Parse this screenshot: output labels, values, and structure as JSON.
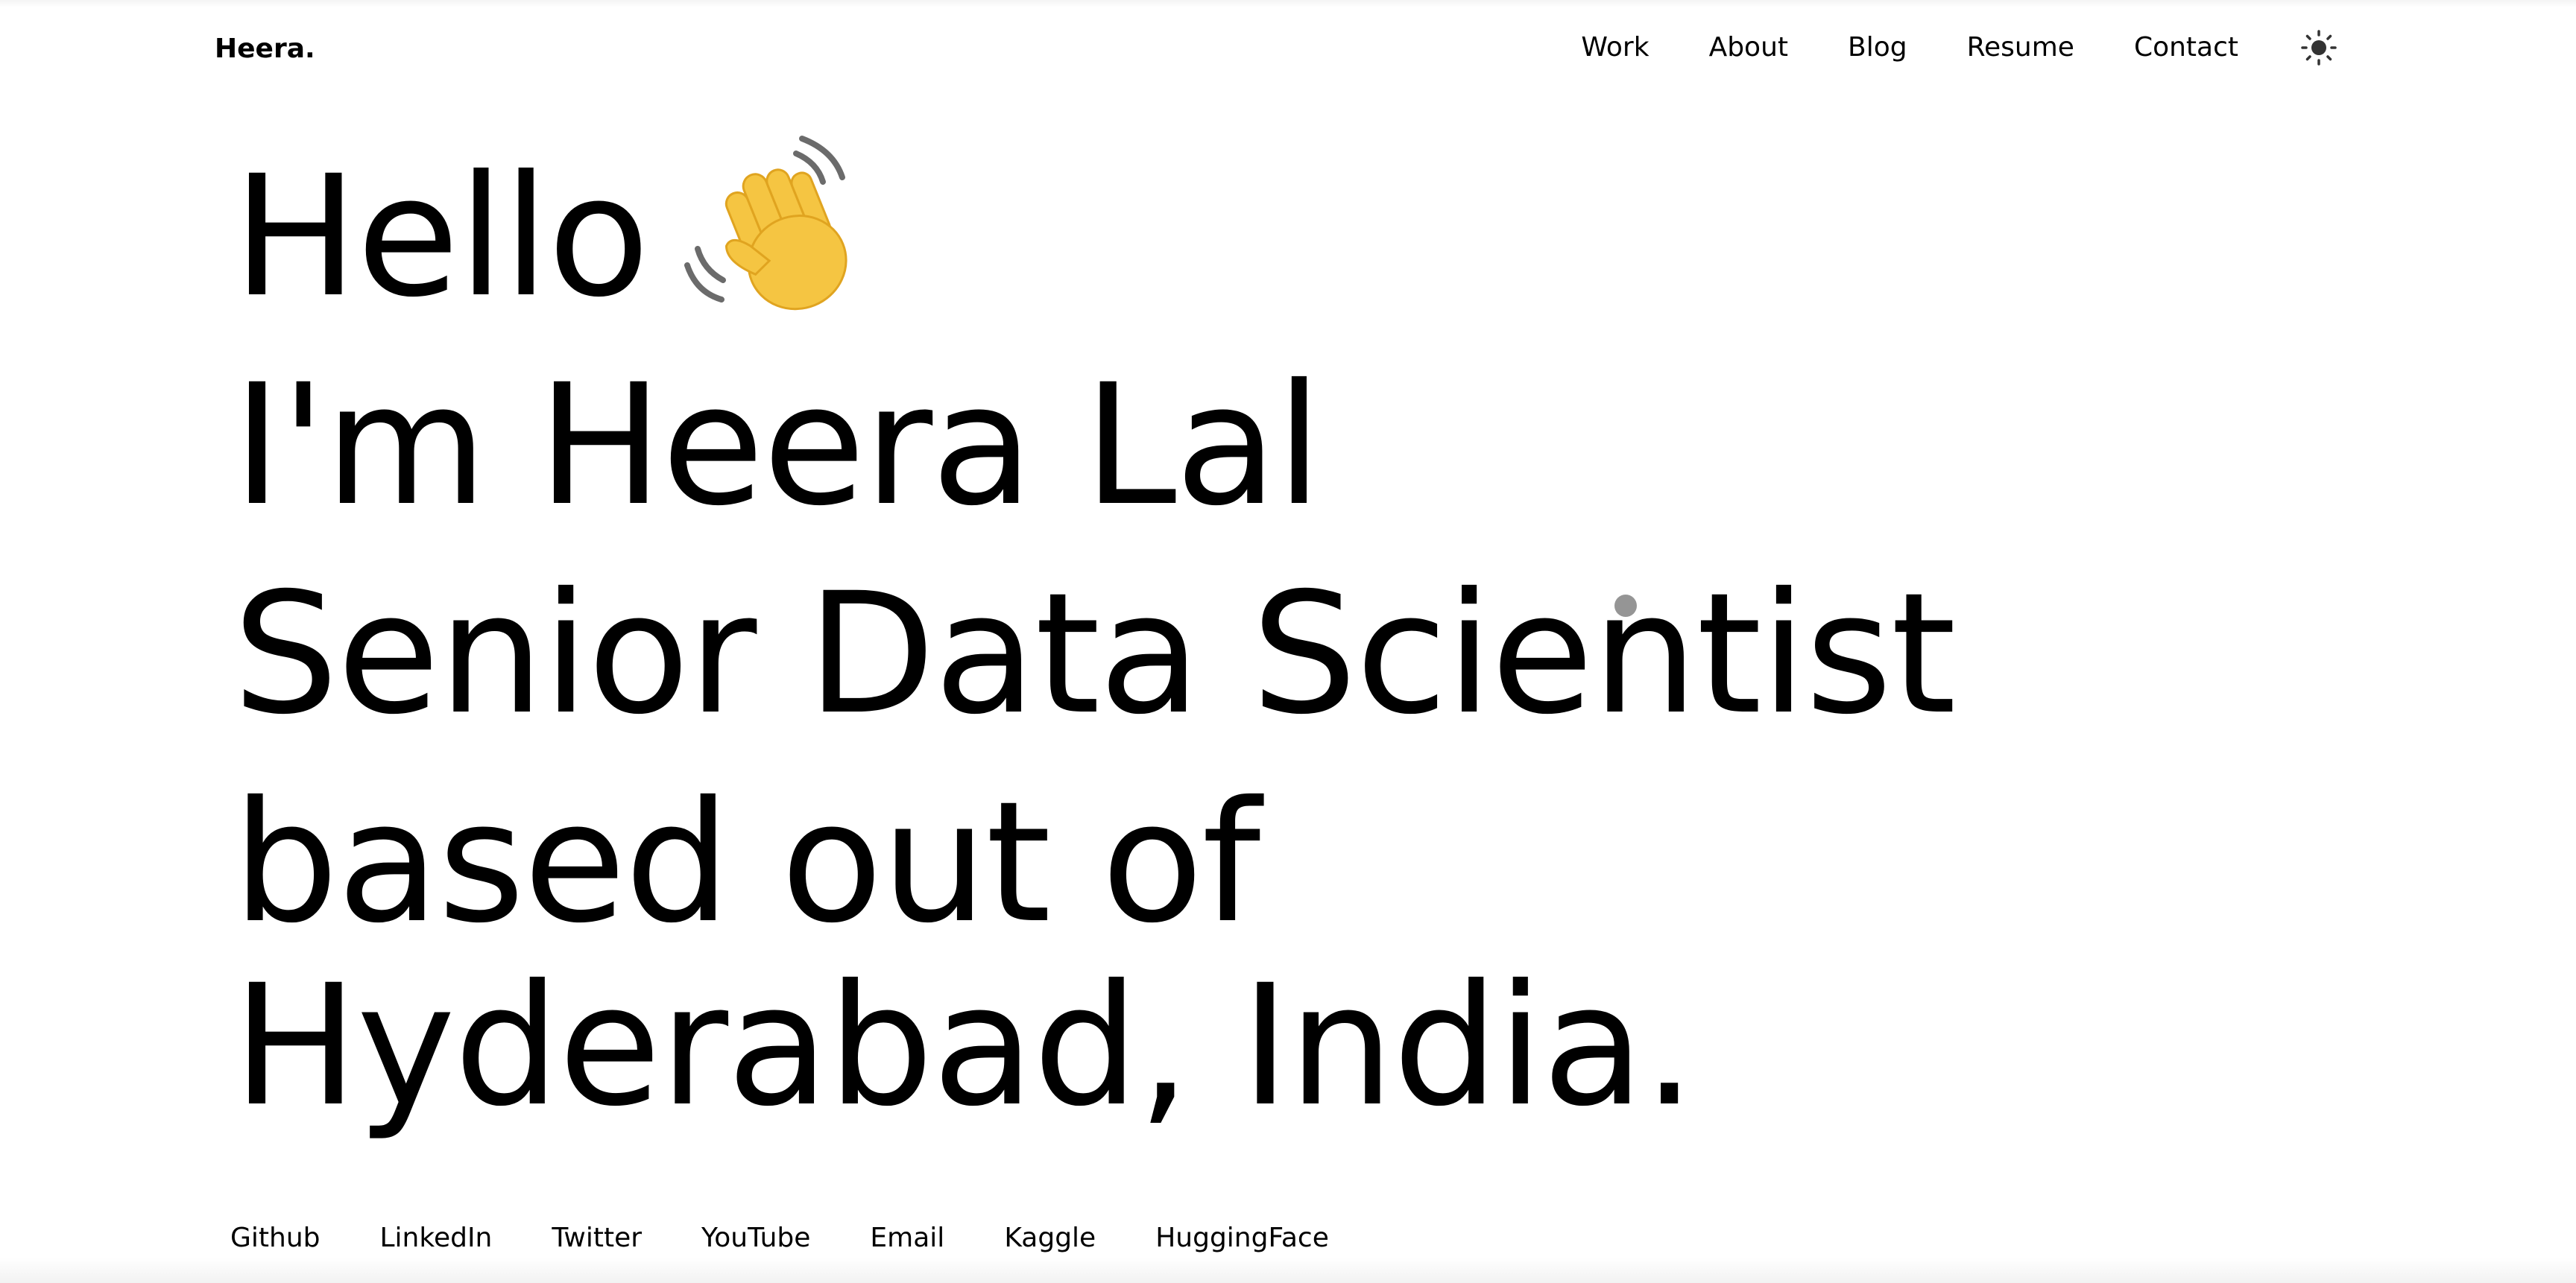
{
  "brand": "Heera.",
  "nav": [
    {
      "label": "Work"
    },
    {
      "label": "About"
    },
    {
      "label": "Blog"
    },
    {
      "label": "Resume"
    },
    {
      "label": "Contact"
    }
  ],
  "theme_toggle_icon": "sun-icon",
  "hero": {
    "line1": "Hello",
    "wave_icon": "waving-hand-icon",
    "line2": "I'm Heera Lal",
    "line3": "Senior Data Scientist",
    "line4": "based out of",
    "line5": "Hyderabad, India."
  },
  "socials": [
    {
      "label": "Github"
    },
    {
      "label": "LinkedIn"
    },
    {
      "label": "Twitter"
    },
    {
      "label": "YouTube"
    },
    {
      "label": "Email"
    },
    {
      "label": "Kaggle"
    },
    {
      "label": "HuggingFace"
    }
  ],
  "colors": {
    "background": "#ffffff",
    "text": "#000000",
    "cursor": "#8a8a8a"
  }
}
